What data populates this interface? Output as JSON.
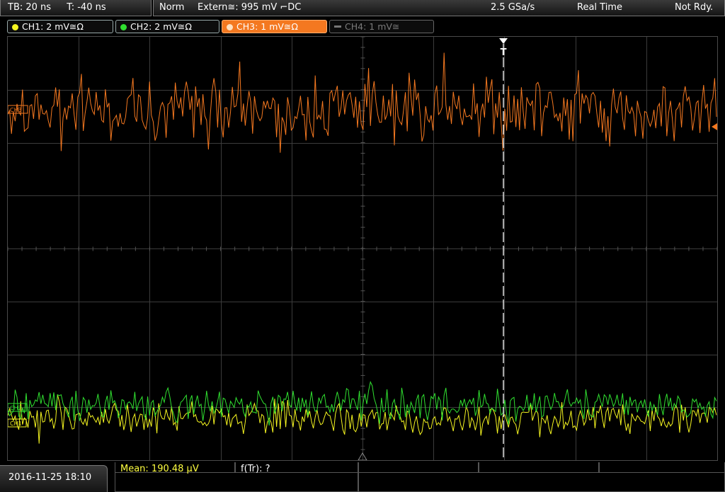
{
  "topbar": {
    "timebase": "TB: 20 ns",
    "trigger_offset": "T: -40 ns",
    "mode": "Norm",
    "trigger_source": "Extern≅: 995 mV ⌐DC",
    "sample_rate": "2.5 GSa/s",
    "acq_mode": "Real Time",
    "status": "Not Rdy."
  },
  "channels": [
    {
      "label": "CH1: 2 mV≅Ω",
      "color": "#f5f520",
      "state": "on"
    },
    {
      "label": "CH2: 2 mV≅Ω",
      "color": "#30e030",
      "state": "on"
    },
    {
      "label": "CH3: 1 mV≅Ω",
      "color": "#f47820",
      "state": "active"
    },
    {
      "label": "CH4: 1 mV≅",
      "color": "#777777",
      "state": "off"
    }
  ],
  "markers": {
    "ch3": "CH3",
    "ch2": "CH2",
    "ch1": "CH1",
    "trigger": "T"
  },
  "colors": {
    "ch1": "#f5f520",
    "ch2": "#30e030",
    "ch3": "#f47820",
    "grid": "#3c3c3c"
  },
  "bottombar": {
    "datetime": "2016-11-25 18:10",
    "mean": "Mean: 190.48 µV",
    "ftr": "f(Tr): ?"
  }
}
